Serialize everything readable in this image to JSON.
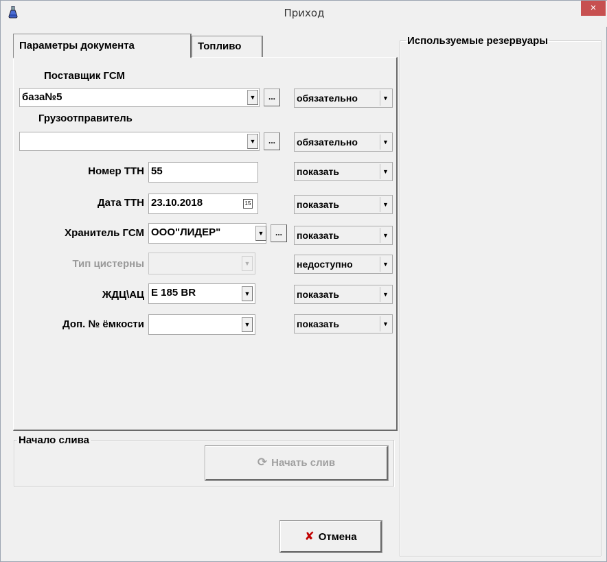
{
  "window": {
    "title": "Приход",
    "close_label": "×"
  },
  "tabs": [
    {
      "label": "Параметры документа"
    },
    {
      "label": "Топливо"
    }
  ],
  "form": {
    "supplier_label": "Поставщик ГСМ",
    "supplier_value": "база№5",
    "supplier_mode": "обязательно",
    "shipper_label": "Грузоотправитель",
    "shipper_value": "",
    "shipper_mode": "обязательно",
    "ttn_number_label": "Номер ТТН",
    "ttn_number_value": "55",
    "ttn_number_mode": "показать",
    "ttn_date_label": "Дата ТТН",
    "ttn_date_value": "23.10.2018",
    "ttn_date_mode": "показать",
    "keeper_label": "Хранитель ГСМ",
    "keeper_value": "ООО\"ЛИДЕР\"",
    "keeper_mode": "показать",
    "tank_type_label": "Тип цистерны",
    "tank_type_value": "",
    "tank_type_mode": "недоступно",
    "railcar_label": "ЖДЦ\\АЦ",
    "railcar_value": "Е 185 BR",
    "railcar_mode": "показать",
    "extra_tank_label": "Доп. № ёмкости",
    "extra_tank_value": "",
    "extra_tank_mode": "показать",
    "ellipsis": "...",
    "calendar_glyph": "15",
    "dropdown_glyph": "▼"
  },
  "drain": {
    "group_label": "Начало слива",
    "start_button": "Начать слив",
    "start_icon": "⟳"
  },
  "reservoirs": {
    "group_label": "Используемые резервуары"
  },
  "footer": {
    "cancel_button": "Отмена",
    "cancel_icon": "✘"
  },
  "colors": {
    "close_bg": "#c75050",
    "cancel_icon": "#c00000"
  }
}
